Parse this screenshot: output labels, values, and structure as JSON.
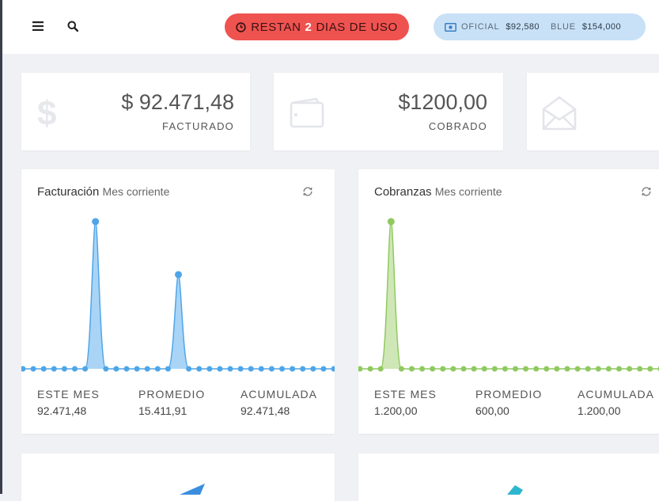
{
  "header": {
    "menu_icon": "hamburger-icon",
    "search_icon": "search-icon",
    "trial": {
      "prefix": "RESTAN",
      "days": "2",
      "suffix": "DIAS DE USO",
      "icon": "clock-icon"
    },
    "rates": {
      "icon": "money-icon",
      "oficial_label": "OFICIAL",
      "oficial_value": "$92,580",
      "blue_label": "BLUE",
      "blue_value": "$154,000"
    }
  },
  "stats": [
    {
      "value": "$ 92.471,48",
      "label": "FACTURADO",
      "icon": "dollar-icon"
    },
    {
      "value": "$1200,00",
      "label": "COBRADO",
      "icon": "wallet-icon"
    },
    {
      "value": "",
      "label": "",
      "icon": "envelope-open-icon"
    }
  ],
  "charts": [
    {
      "title": "Facturación",
      "subtitle": "Mes corriente",
      "color": "#4ea6e8",
      "fill": "#a9d4f6",
      "refresh_icon": "refresh-icon",
      "footer": [
        {
          "label": "ESTE MES",
          "value": "92.471,48"
        },
        {
          "label": "PROMEDIO",
          "value": "15.411,91"
        },
        {
          "label": "ACUMULADA",
          "value": "92.471,48"
        }
      ]
    },
    {
      "title": "Cobranzas",
      "subtitle": "Mes corriente",
      "color": "#8fc960",
      "fill": "#cfe7b6",
      "refresh_icon": "refresh-icon",
      "footer": [
        {
          "label": "ESTE MES",
          "value": "1.200,00"
        },
        {
          "label": "PROMEDIO",
          "value": "600,00"
        },
        {
          "label": "ACUMULADA",
          "value": "1.200,00"
        }
      ]
    }
  ],
  "chart_data": [
    {
      "type": "area",
      "series": [
        {
          "values": [
            0,
            0,
            0,
            0,
            0,
            0,
            0,
            100,
            0,
            0,
            0,
            0,
            0,
            0,
            0,
            64,
            0,
            0,
            0,
            0,
            0,
            0,
            0,
            0,
            0,
            0,
            0,
            0,
            0,
            0,
            0
          ]
        }
      ]
    },
    {
      "type": "area",
      "series": [
        {
          "values": [
            0,
            0,
            0,
            100,
            0,
            0,
            0,
            0,
            0,
            0,
            0,
            0,
            0,
            0,
            0,
            0,
            0,
            0,
            0,
            0,
            0,
            0,
            0,
            0,
            0,
            0,
            0,
            0,
            0,
            0
          ]
        }
      ]
    }
  ]
}
